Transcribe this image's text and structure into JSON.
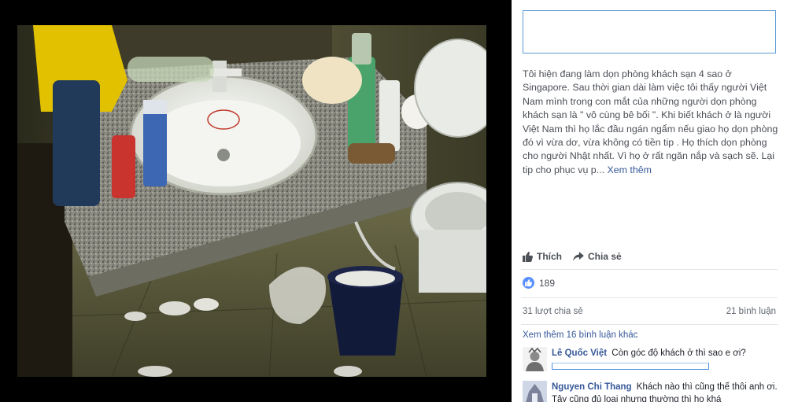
{
  "post": {
    "caption": "Tôi hiện đang làm dọn phòng khách sạn 4 sao ở Singapore. Sau thời gian dài làm việc tôi thấy người Việt Nam mình trong con mắt của những người dọn phòng khách sạn là \" vô cùng bê bối \". Khi biết khách ở là người Việt Nam thì họ lắc đầu ngán ngẩm nếu giao họ dọn phòng đó vì vừa dơ, vừa không có tiền tip . Họ thích dọn phòng cho người Nhật nhất. Vì họ ở rất ngăn nắp và sạch sẽ. Lại tip cho phục vụ p...",
    "see_more": "Xem thêm"
  },
  "actions": {
    "like_label": "Thích",
    "share_label": "Chia sẻ"
  },
  "stats": {
    "reaction_count": "189",
    "shares": "31 lượt chia sẻ",
    "comments": "21 bình luận"
  },
  "comments_section": {
    "more_label": "Xem thêm 16 bình luận khác",
    "items": [
      {
        "name": "Lê Quốc Việt",
        "text": "Còn góc độ khách ở thì sao e ơi?"
      },
      {
        "name": "Nguyen Chi Thang",
        "text": "Khách nào thì cũng thế thôi anh ơi. Tây cũng đủ loại nhưng thường thì họ khá"
      }
    ]
  },
  "icons": {
    "like": "thumbs-up-icon",
    "share": "share-arrow-icon",
    "reaction": "like-reaction-icon"
  },
  "colors": {
    "link": "#365899",
    "reaction_blue": "#5890ff",
    "input_border": "#5b9bd5"
  }
}
